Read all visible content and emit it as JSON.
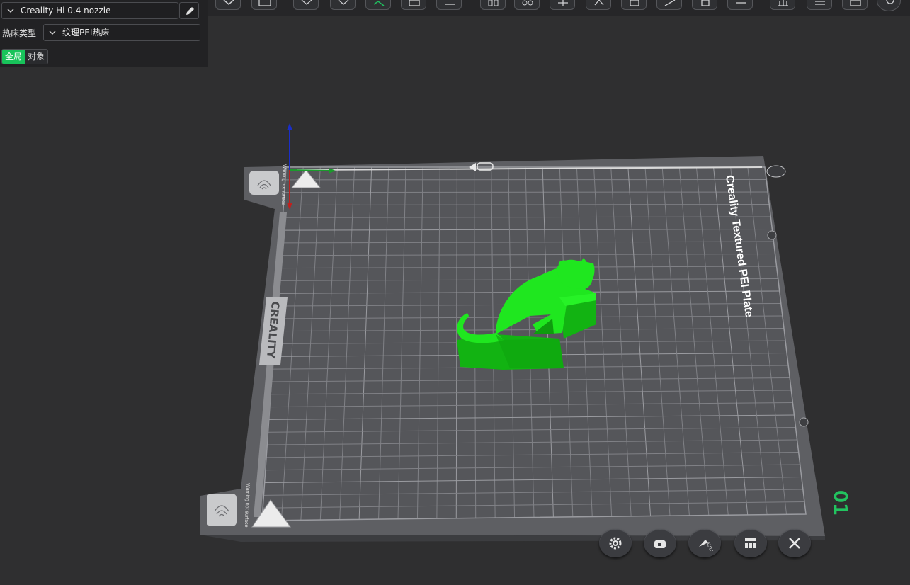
{
  "left_panel": {
    "printer_preset": "Creality Hi 0.4 nozzle",
    "bed_type_label": "热床类型",
    "bed_type_value": "纹理PEI热床",
    "scope_tabs": [
      {
        "label": "全局",
        "active": true
      },
      {
        "label": "对象",
        "active": false
      }
    ]
  },
  "plate": {
    "title_text": "Creality Textured PEI Plate",
    "brand_text": "CREALITY",
    "warning_text": "Warning hot surface",
    "plate_number": "01"
  },
  "toolbar": {
    "icons": [
      "cube-view-icon",
      "keyboard-icon",
      "cube-top-icon",
      "cube-bottom-icon",
      "slice-view-icon",
      "arrange-icon",
      "layout-icon",
      "split-objects-icon",
      "split-parts-icon",
      "move-icon",
      "rotate-icon",
      "scale-icon",
      "cut-icon",
      "support-paint-icon",
      "seam-icon",
      "measure-icon",
      "variable-layer-icon",
      "emboss-icon",
      "assembly-icon"
    ]
  },
  "plate_tools": {
    "icons": [
      "settings-icon",
      "lock-icon",
      "auto-orient-icon",
      "arrange-icon",
      "close-icon"
    ],
    "auto_label": "AUTO"
  },
  "colors": {
    "model": "#1fe71f",
    "model_shade": "#12b312",
    "accent": "#18c35a",
    "plate": "#5e5f63",
    "grid": "#7b7c80"
  }
}
